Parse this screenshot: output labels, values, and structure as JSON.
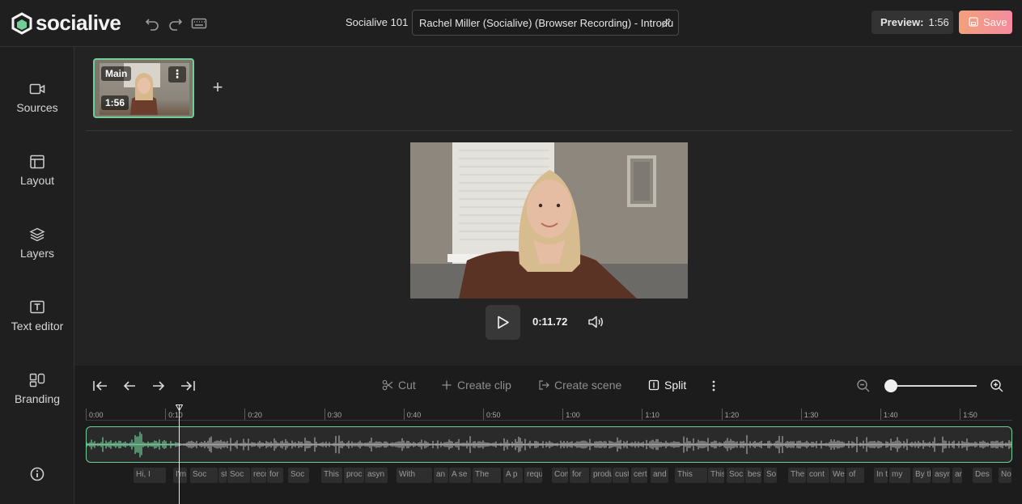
{
  "app": {
    "logo_text": "socialive",
    "brand_color": "#6fcf97",
    "accent_save": "#f58b9e"
  },
  "header": {
    "project_name": "Socialive 101",
    "video_title": "Rachel Miller (Socialive) (Browser Recording) - Introdu",
    "preview_label": "Preview:",
    "preview_duration": "1:56",
    "save_label": "Save",
    "icons": [
      "undo-icon",
      "redo-icon",
      "keyboard-icon",
      "pencil-icon",
      "save-icon"
    ]
  },
  "sidebar": {
    "items": [
      {
        "label": "Sources",
        "icon": "camera-icon"
      },
      {
        "label": "Layout",
        "icon": "layout-icon"
      },
      {
        "label": "Layers",
        "icon": "layers-icon"
      },
      {
        "label": "Text editor",
        "icon": "text-icon"
      },
      {
        "label": "Branding",
        "icon": "branding-icon"
      }
    ],
    "info_icon": "info-icon"
  },
  "scenes": [
    {
      "label": "Main",
      "duration": "1:56",
      "selected": true
    }
  ],
  "player": {
    "current_time": "0:11.72",
    "icons": [
      "play-icon",
      "volume-icon"
    ]
  },
  "toolbar": {
    "nav_icons": [
      "jump-start-icon",
      "step-back-icon",
      "step-forward-icon",
      "jump-end-icon"
    ],
    "cut_label": "Cut",
    "create_clip_label": "Create clip",
    "create_scene_label": "Create scene",
    "split_label": "Split",
    "zoom_level": 0.0
  },
  "timeline": {
    "ticks": [
      "0:00",
      "0:10",
      "0:20",
      "0:30",
      "0:40",
      "0:50",
      "1:00",
      "1:10",
      "1:20",
      "1:30",
      "1:40",
      "1:50"
    ],
    "playhead_time": "0:11.72",
    "captions": [
      "Hi, I",
      "I'm",
      "Soc",
      "st",
      "Soc",
      "reco",
      "for",
      "Soc",
      "This",
      "proc",
      "asyn",
      "With",
      "an",
      "A se",
      "The",
      "A p",
      "requ",
      "Con",
      "for",
      "produ",
      "cust",
      "cert",
      "and",
      "This",
      "This",
      "Soc",
      "best",
      "So",
      "The",
      "cont",
      "We'l",
      "of",
      "In th",
      "my",
      "By th",
      "asyn",
      "ar",
      "Des",
      "No"
    ]
  }
}
